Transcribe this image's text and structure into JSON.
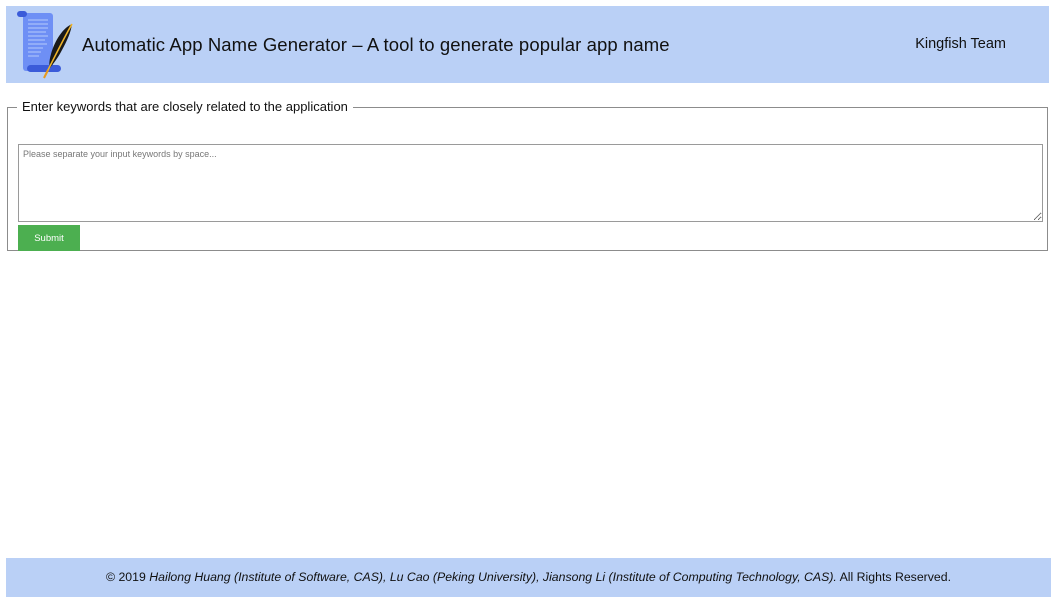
{
  "header": {
    "title": "Automatic App Name Generator – A tool to generate popular app name",
    "team": "Kingfish Team",
    "logo_icon": "scroll-quill-icon",
    "background_color": "#bad0f6"
  },
  "form": {
    "legend": "Enter keywords that are closely related to the application",
    "keywords_value": "",
    "keywords_placeholder": "Please separate your input keywords by space...",
    "submit_label": "Submit",
    "submit_color": "#4caf50"
  },
  "footer": {
    "copyright": "© 2019",
    "authors": "Hailong Huang (Institute of Software, CAS), Lu Cao (Peking University), Jiansong Li (Institute of Computing Technology, CAS).",
    "rights": "All Rights Reserved.",
    "background_color": "#bad0f6"
  }
}
